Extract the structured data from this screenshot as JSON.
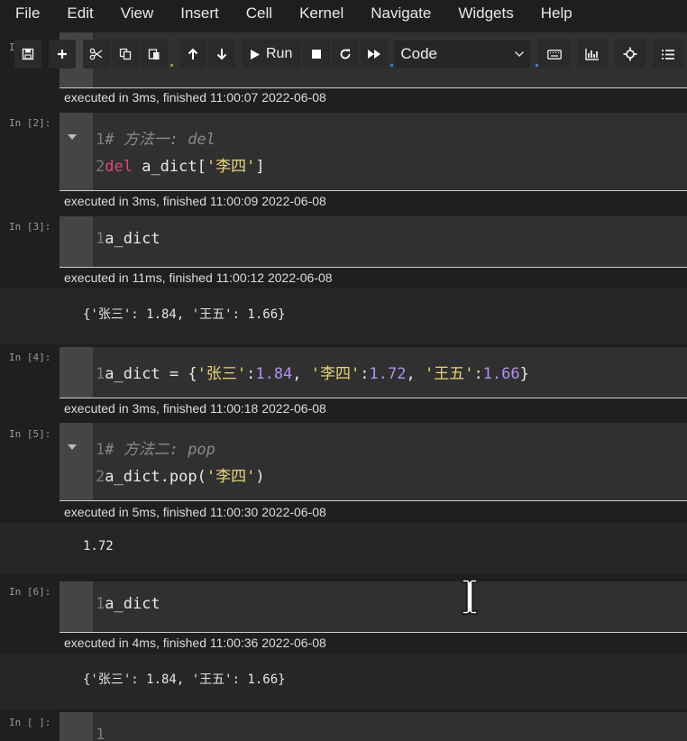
{
  "menu": [
    "File",
    "Edit",
    "View",
    "Insert",
    "Cell",
    "Kernel",
    "Navigate",
    "Widgets",
    "Help"
  ],
  "toolbar": {
    "run_label": "Run",
    "cell_type": "Code",
    "icons": [
      "save-icon",
      "plus-icon",
      "scissors-icon",
      "copy-icon",
      "paste-icon",
      "arrow-up-icon",
      "arrow-down-icon",
      "play-icon",
      "stop-icon",
      "restart-icon",
      "fast-forward-icon",
      "keyboard-icon",
      "chart-icon",
      "crosshair-icon",
      "list-icon"
    ]
  },
  "cells": [
    {
      "prompt": "In [",
      "exec": "executed in 3ms, finished 11:00:07 2022-06-08"
    },
    {
      "prompt": "In [2]:",
      "line1_num": "1",
      "line1_comment": "# 方法一: del",
      "line2_num": "2",
      "line2_kw": "del",
      "line2_mid": " a_dict[",
      "line2_str": "'李四'",
      "line2_end": "]",
      "exec": "executed in 3ms, finished 11:00:09 2022-06-08"
    },
    {
      "prompt": "In [3]:",
      "line1_num": "1",
      "line1_code": "a_dict",
      "exec": "executed in 11ms, finished 11:00:12 2022-06-08",
      "output": "{'张三': 1.84, '王五': 1.66}"
    },
    {
      "prompt": "In [4]:",
      "line1_num": "1",
      "p1": "a_dict = {",
      "s1": "'张三'",
      "c1": ":",
      "n1": "1.84",
      "p2": ", ",
      "s2": "'李四'",
      "c2": ":",
      "n2": "1.72",
      "p3": ", ",
      "s3": "'王五'",
      "c3": ":",
      "n3": "1.66",
      "p4": "}",
      "exec": "executed in 3ms, finished 11:00:18 2022-06-08"
    },
    {
      "prompt": "In [5]:",
      "line1_num": "1",
      "line1_comment": "# 方法二: pop",
      "line2_num": "2",
      "line2_mid": "a_dict.pop(",
      "line2_str": "'李四'",
      "line2_end": ")",
      "exec": "executed in 5ms, finished 11:00:30 2022-06-08",
      "output": "1.72"
    },
    {
      "prompt": "In [6]:",
      "line1_num": "1",
      "line1_code": "a_dict",
      "exec": "executed in 4ms, finished 11:00:36 2022-06-08",
      "output": "{'张三': 1.84, '王五': 1.66}"
    },
    {
      "prompt": "In [ ]:",
      "line1_num": "1"
    }
  ]
}
